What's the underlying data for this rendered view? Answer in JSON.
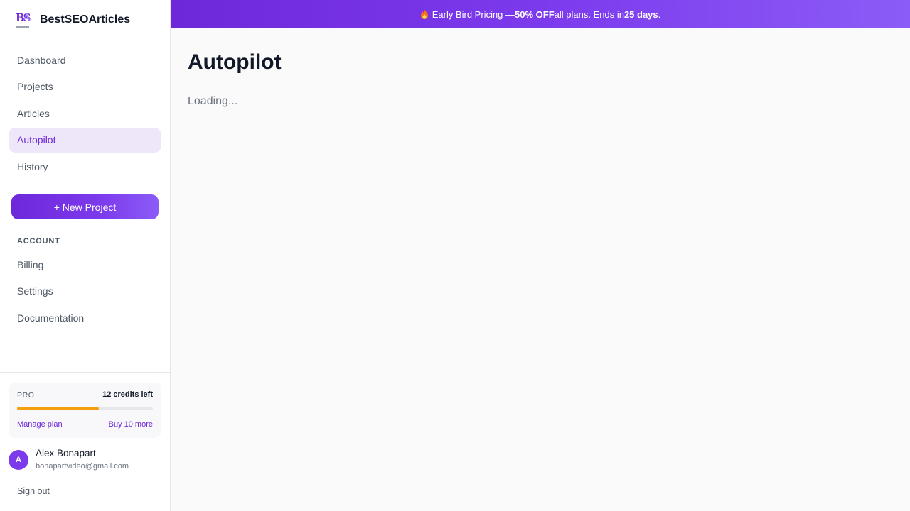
{
  "brand": {
    "name": "BestSEOArticles",
    "logo_text": "BSA"
  },
  "nav": {
    "items": [
      {
        "label": "Dashboard",
        "active": false
      },
      {
        "label": "Projects",
        "active": false
      },
      {
        "label": "Articles",
        "active": false
      },
      {
        "label": "Autopilot",
        "active": true
      },
      {
        "label": "History",
        "active": false
      }
    ],
    "new_project_label": "+ New Project"
  },
  "account": {
    "section_label": "ACCOUNT",
    "items": [
      {
        "label": "Billing"
      },
      {
        "label": "Settings"
      },
      {
        "label": "Documentation"
      }
    ]
  },
  "plan": {
    "name": "PRO",
    "credits_text": "12 credits left",
    "credits_fraction": 0.6,
    "manage_label": "Manage plan",
    "buy_label": "Buy 10 more"
  },
  "user": {
    "initial": "A",
    "name": "Alex Bonapart",
    "email": "bonapartvideo@gmail.com",
    "signout_label": "Sign out"
  },
  "banner": {
    "icon": "fire-icon",
    "prefix": "Early Bird Pricing — ",
    "discount": "50% OFF",
    "middle": " all plans. Ends in ",
    "days": "25 days",
    "suffix": "."
  },
  "main": {
    "title": "Autopilot",
    "status": "Loading..."
  },
  "colors": {
    "accent": "#6d28d9",
    "active_bg": "#ede7f9",
    "progress": "#f59e0b"
  }
}
